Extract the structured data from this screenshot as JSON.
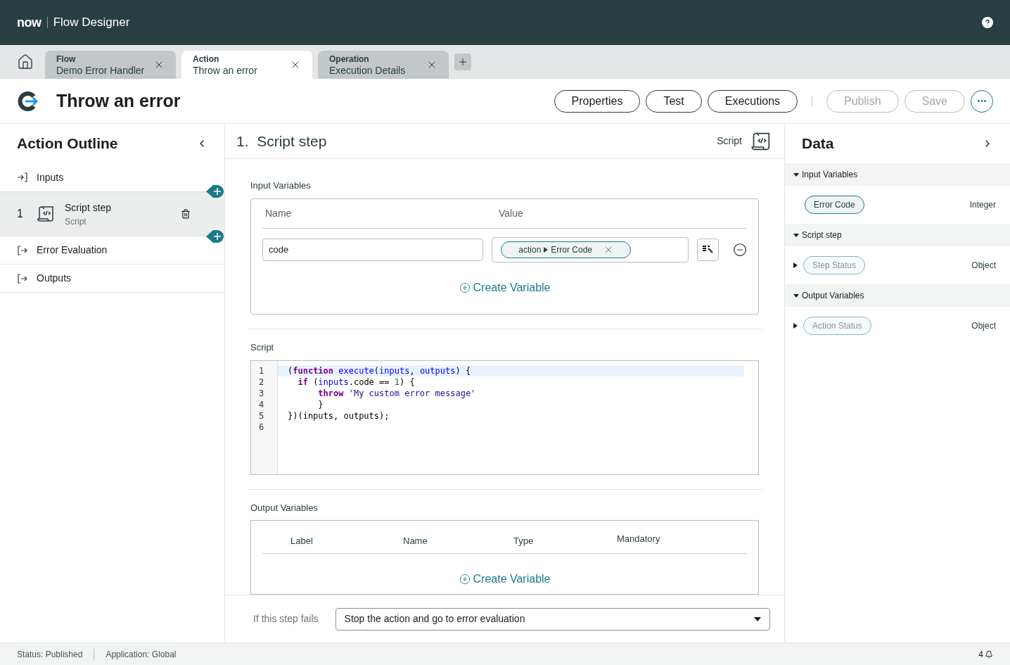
{
  "header": {
    "logo": "now",
    "title": "Flow Designer"
  },
  "tabs": [
    {
      "type": "Flow",
      "name": "Demo Error Handler",
      "selected": false
    },
    {
      "type": "Action",
      "name": "Throw an error",
      "selected": true
    },
    {
      "type": "Operation",
      "name": "Execution Details",
      "selected": false
    }
  ],
  "page_title": "Throw an error",
  "toolbar": [
    {
      "label": "Properties",
      "disabled": false
    },
    {
      "label": "Test",
      "disabled": false
    },
    {
      "label": "Executions",
      "disabled": false
    },
    {
      "label": "Publish",
      "disabled": true
    },
    {
      "label": "Save",
      "disabled": true
    }
  ],
  "outline": {
    "title": "Action Outline",
    "items": [
      {
        "kind": "input",
        "label": "Inputs",
        "selected": false
      },
      {
        "kind": "step",
        "number": "1",
        "label": "Script step",
        "subtitle": "Script",
        "selected": true
      },
      {
        "kind": "output",
        "label": "Error Evaluation",
        "selected": false
      },
      {
        "kind": "output",
        "label": "Outputs",
        "selected": false
      }
    ]
  },
  "step": {
    "number": "1.",
    "title": "Script step",
    "type_label": "Script"
  },
  "input_variables": {
    "title": "Input Variables",
    "columns": [
      "Name",
      "Value"
    ],
    "rows": [
      {
        "name": "code",
        "value_root": "action",
        "value_field": "Error Code"
      }
    ],
    "create_label": "Create Variable"
  },
  "script": {
    "title": "Script",
    "lines": [
      {
        "number": "1",
        "active": true,
        "tokens": [
          {
            "kind": "plain",
            "text": "("
          },
          {
            "kind": "keyword",
            "text": "function"
          },
          {
            "kind": "variable",
            "text": " execute"
          },
          {
            "kind": "plain",
            "text": "("
          },
          {
            "kind": "variable",
            "text": "inputs"
          },
          {
            "kind": "plain",
            "text": ", "
          },
          {
            "kind": "variable",
            "text": "outputs"
          },
          {
            "kind": "plain",
            "text": ") {"
          }
        ]
      },
      {
        "number": "2",
        "active": false,
        "tokens": [
          {
            "kind": "keyword",
            "text": "  if"
          },
          {
            "kind": "plain",
            "text": " ("
          },
          {
            "kind": "variable",
            "text": "inputs"
          },
          {
            "kind": "plain",
            "text": ".code == "
          },
          {
            "kind": "number",
            "text": "1"
          },
          {
            "kind": "plain",
            "text": ") {"
          }
        ]
      },
      {
        "number": "3",
        "active": false,
        "tokens": [
          {
            "kind": "keyword",
            "text": "      throw"
          },
          {
            "kind": "string",
            "text": " 'My custom error message'"
          }
        ]
      },
      {
        "number": "4",
        "active": false,
        "tokens": [
          {
            "kind": "plain",
            "text": "      }"
          }
        ]
      },
      {
        "number": "5",
        "active": false,
        "tokens": [
          {
            "kind": "plain",
            "text": "})(inputs, outputs);"
          }
        ]
      },
      {
        "number": "6",
        "active": false
      }
    ]
  },
  "output_variables": {
    "title": "Output Variables",
    "columns": [
      "Label",
      "Name",
      "Type",
      "Mandatory"
    ],
    "create_label": "Create Variable"
  },
  "failure": {
    "label": "If this step fails",
    "value": "Stop the action and go to error evaluation"
  },
  "data_panel": {
    "title": "Data",
    "groups": [
      {
        "label": "Input Variables",
        "expanded": true,
        "items": [
          {
            "label": "Error Code",
            "type": "Integer",
            "expandable": false,
            "disabled": false
          }
        ]
      },
      {
        "label": "Script step",
        "expanded": true,
        "items": [
          {
            "label": "Step Status",
            "type": "Object",
            "expandable": true,
            "disabled": true
          }
        ]
      },
      {
        "label": "Output Variables",
        "expanded": true,
        "items": [
          {
            "label": "Action Status",
            "type": "Object",
            "expandable": true,
            "disabled": true
          }
        ]
      }
    ]
  },
  "status_bar": {
    "status": "Status: Published",
    "application": "Application: Global",
    "notifications": "4"
  }
}
